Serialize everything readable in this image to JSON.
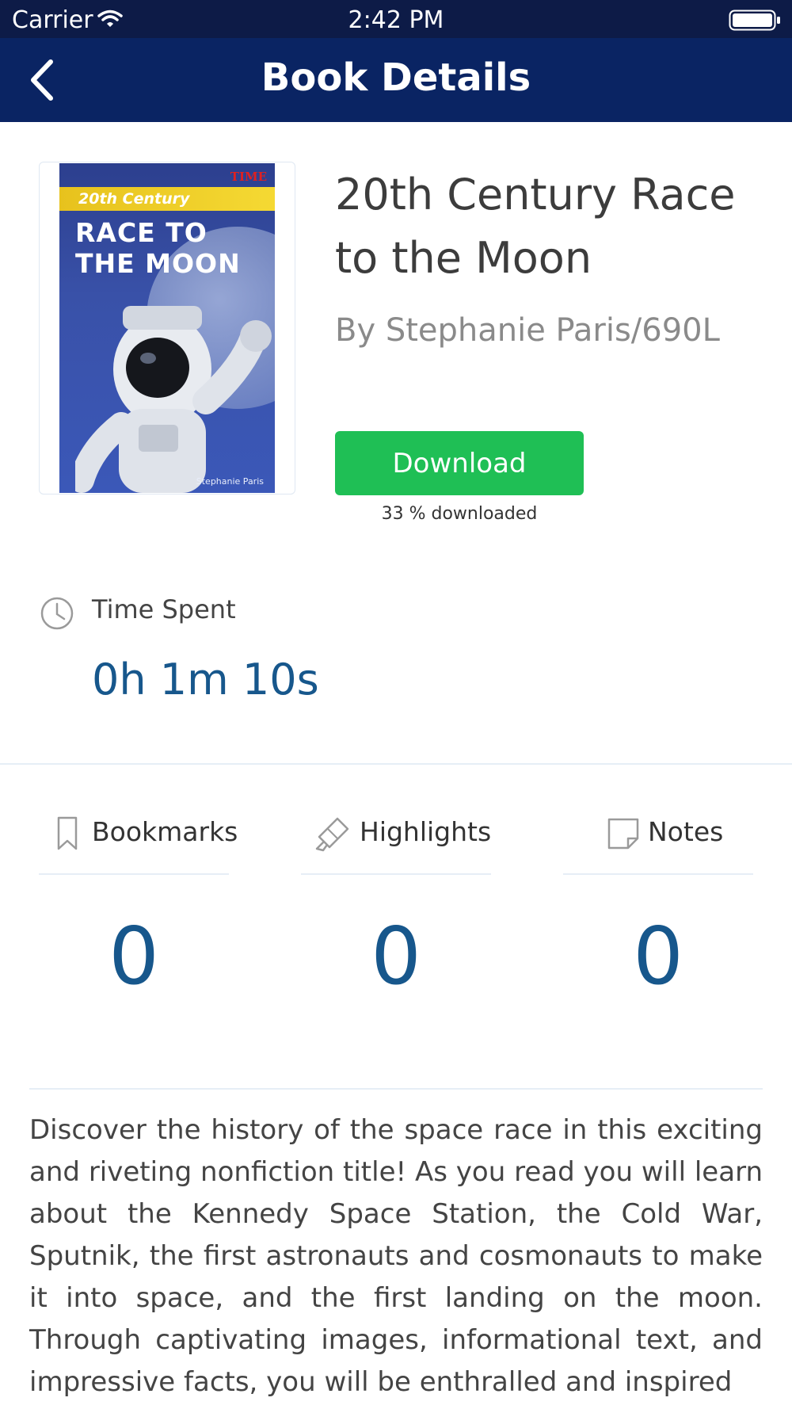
{
  "status_bar": {
    "carrier": "Carrier",
    "time": "2:42 PM"
  },
  "nav": {
    "title": "Book Details"
  },
  "book": {
    "title": "20th Century Race to the Moon",
    "author_line": "By Stephanie Paris/690L",
    "cover": {
      "brand": "TIME",
      "series": "20th Century",
      "title": "RACE TO THE MOON",
      "author": "Stephanie Paris"
    }
  },
  "download": {
    "label": "Download",
    "progress_text": "33 % downloaded",
    "progress": 0.33,
    "color": "#1fbf55"
  },
  "time_spent": {
    "label": "Time Spent",
    "value": "0h 1m 10s"
  },
  "stats": {
    "bookmarks": {
      "label": "Bookmarks",
      "count": "0"
    },
    "highlights": {
      "label": "Highlights",
      "count": "0"
    },
    "notes": {
      "label": "Notes",
      "count": "0"
    }
  },
  "description": "Discover the history of the space race in this exciting and riveting nonfiction title! As you read you will learn about the Kennedy Space Station, the Cold War, Sputnik, the first astronauts and cosmonauts to make it into space, and the first landing on the moon. Through captivating images, informational text, and impressive facts, you will be enthralled and inspired",
  "colors": {
    "nav_bg": "#0a2463",
    "status_bg": "#0d1b47",
    "accent_value": "#17578c",
    "download_green": "#1fbf55"
  },
  "icons": [
    "wifi-icon",
    "battery-icon",
    "back-icon",
    "clock-icon",
    "bookmark-icon",
    "highlighter-icon",
    "note-icon"
  ]
}
